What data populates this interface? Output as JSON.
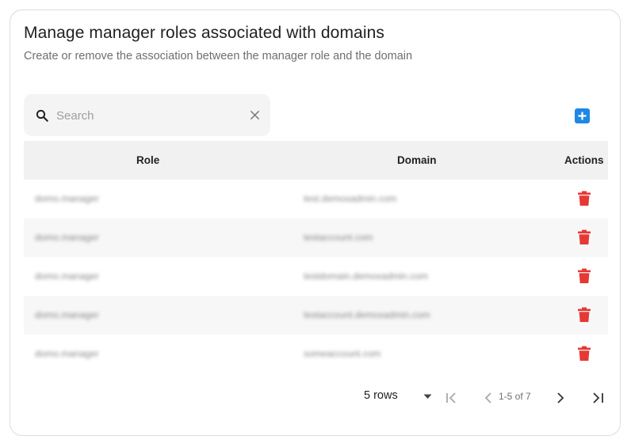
{
  "header": {
    "title": "Manage manager roles associated with domains",
    "subtitle": "Create or remove the association between the manager role and the domain"
  },
  "search": {
    "placeholder": "Search",
    "value": "",
    "icon": "search-icon",
    "clear_icon": "close-icon"
  },
  "toolbar": {
    "add_icon": "plus-square-icon"
  },
  "table": {
    "columns": [
      "Role",
      "Domain",
      "Actions"
    ],
    "rows": [
      {
        "role": "domo.manager",
        "domain": "test.demoxadmin.com"
      },
      {
        "role": "domo.manager",
        "domain": "testaccount.com"
      },
      {
        "role": "domo.manager",
        "domain": "testdomain.demoxadmin.com"
      },
      {
        "role": "domo.manager",
        "domain": "testaccount.demoxadmin.com"
      },
      {
        "role": "domo.manager",
        "domain": "someaccount.com"
      }
    ],
    "row_action_icon": "trash-icon"
  },
  "pagination": {
    "rows_label": "5 rows",
    "range": "1-5 of 7"
  },
  "colors": {
    "accent": "#1e88e5",
    "danger": "#e53935",
    "header_bg": "#f1f1f1"
  }
}
